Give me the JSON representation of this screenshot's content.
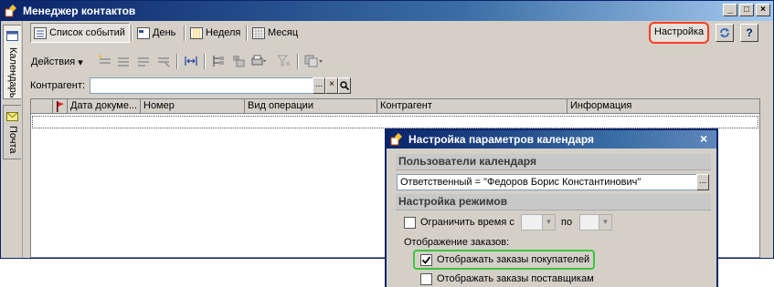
{
  "window": {
    "title": "Менеджер контактов",
    "controls": [
      "_",
      "□",
      "×"
    ]
  },
  "side_tabs": [
    {
      "label": "Календарь",
      "active": true,
      "icon": "calendar-icon"
    },
    {
      "label": "Почта",
      "active": false,
      "icon": "mail-icon"
    }
  ],
  "toolbar": {
    "event_list": "Список событий",
    "day": "День",
    "week": "Неделя",
    "month": "Месяц",
    "settings": "Настройка",
    "refresh_icon": "refresh-icon",
    "help": "?"
  },
  "actions": {
    "label": "Действия",
    "arrow": "▾"
  },
  "filter": {
    "label": "Контрагент:",
    "value": "",
    "select_btn": "...",
    "clear_btn": "×"
  },
  "table": {
    "columns": [
      "Дата докуме...",
      "Номер",
      "Вид операции",
      "Контрагент",
      "Информация"
    ],
    "rows": []
  },
  "dialog": {
    "title": "Настройка параметров календаря",
    "close": "×",
    "users_section": "Пользователи календаря",
    "responsible": "Ответственный = \"Федоров Борис Константинович\"",
    "responsible_btn": "...",
    "modes_section": "Настройка режимов",
    "limit_time": {
      "label": "Ограничить время с",
      "checked": false,
      "to": "по"
    },
    "orders_label": "Отображение заказов:",
    "show_customer_orders": {
      "label": "Отображать заказы покупателей",
      "checked": true
    },
    "show_supplier_orders": {
      "label": "Отображать заказы поставщикам",
      "checked": false
    }
  },
  "colors": {
    "title_bar": "#0a246a",
    "settings_highlight": "#ff3b1f",
    "option_highlight": "#3cc43c"
  }
}
